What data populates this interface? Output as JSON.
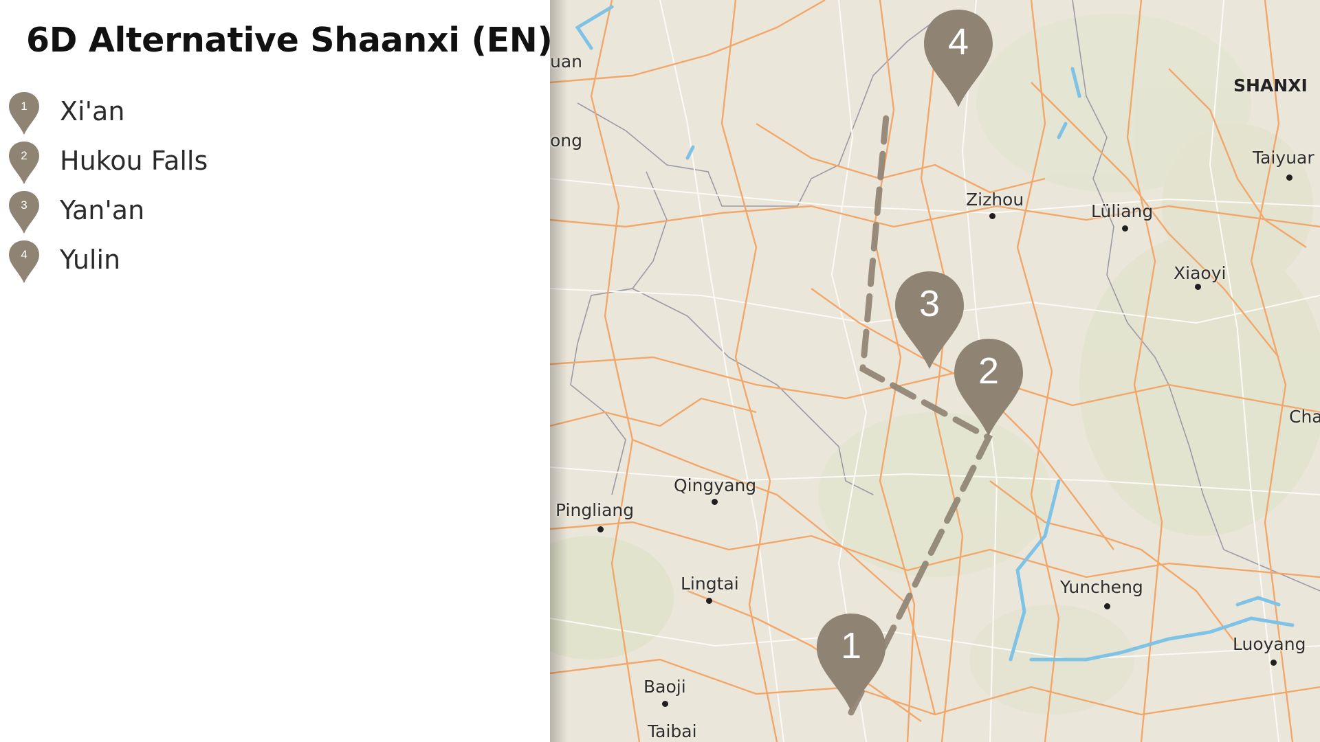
{
  "title": "6D Alternative Shaanxi (EN)",
  "stops": [
    {
      "number": "1",
      "name": "Xi'an"
    },
    {
      "number": "2",
      "name": "Hukou Falls"
    },
    {
      "number": "3",
      "name": "Yan'an"
    },
    {
      "number": "4",
      "name": "Yulin"
    }
  ],
  "map": {
    "region_label": "SHANXI",
    "cities": {
      "zizhou": "Zizhou",
      "luliang": "Lüliang",
      "taiyuan": "Taiyuar",
      "xiaoyi": "Xiaoyi",
      "qingyang": "Qingyang",
      "pingliang": "Pingliang",
      "lingtai": "Lingtai",
      "yuncheng": "Yuncheng",
      "luoyang": "Luoyang",
      "baoji": "Baoji",
      "taibai": "Taibai",
      "partial_uan": "uan",
      "partial_ong": "ong",
      "partial_cha": "Cha"
    },
    "pin_numbers": {
      "p1": "1",
      "p2": "2",
      "p3": "3",
      "p4": "4"
    }
  },
  "colors": {
    "pin": "#8f8474",
    "pin_text": "#ffffff",
    "route": "#8f8474",
    "road": "#f0a060",
    "land": "#ebe6da",
    "water": "#7ec3e6"
  }
}
